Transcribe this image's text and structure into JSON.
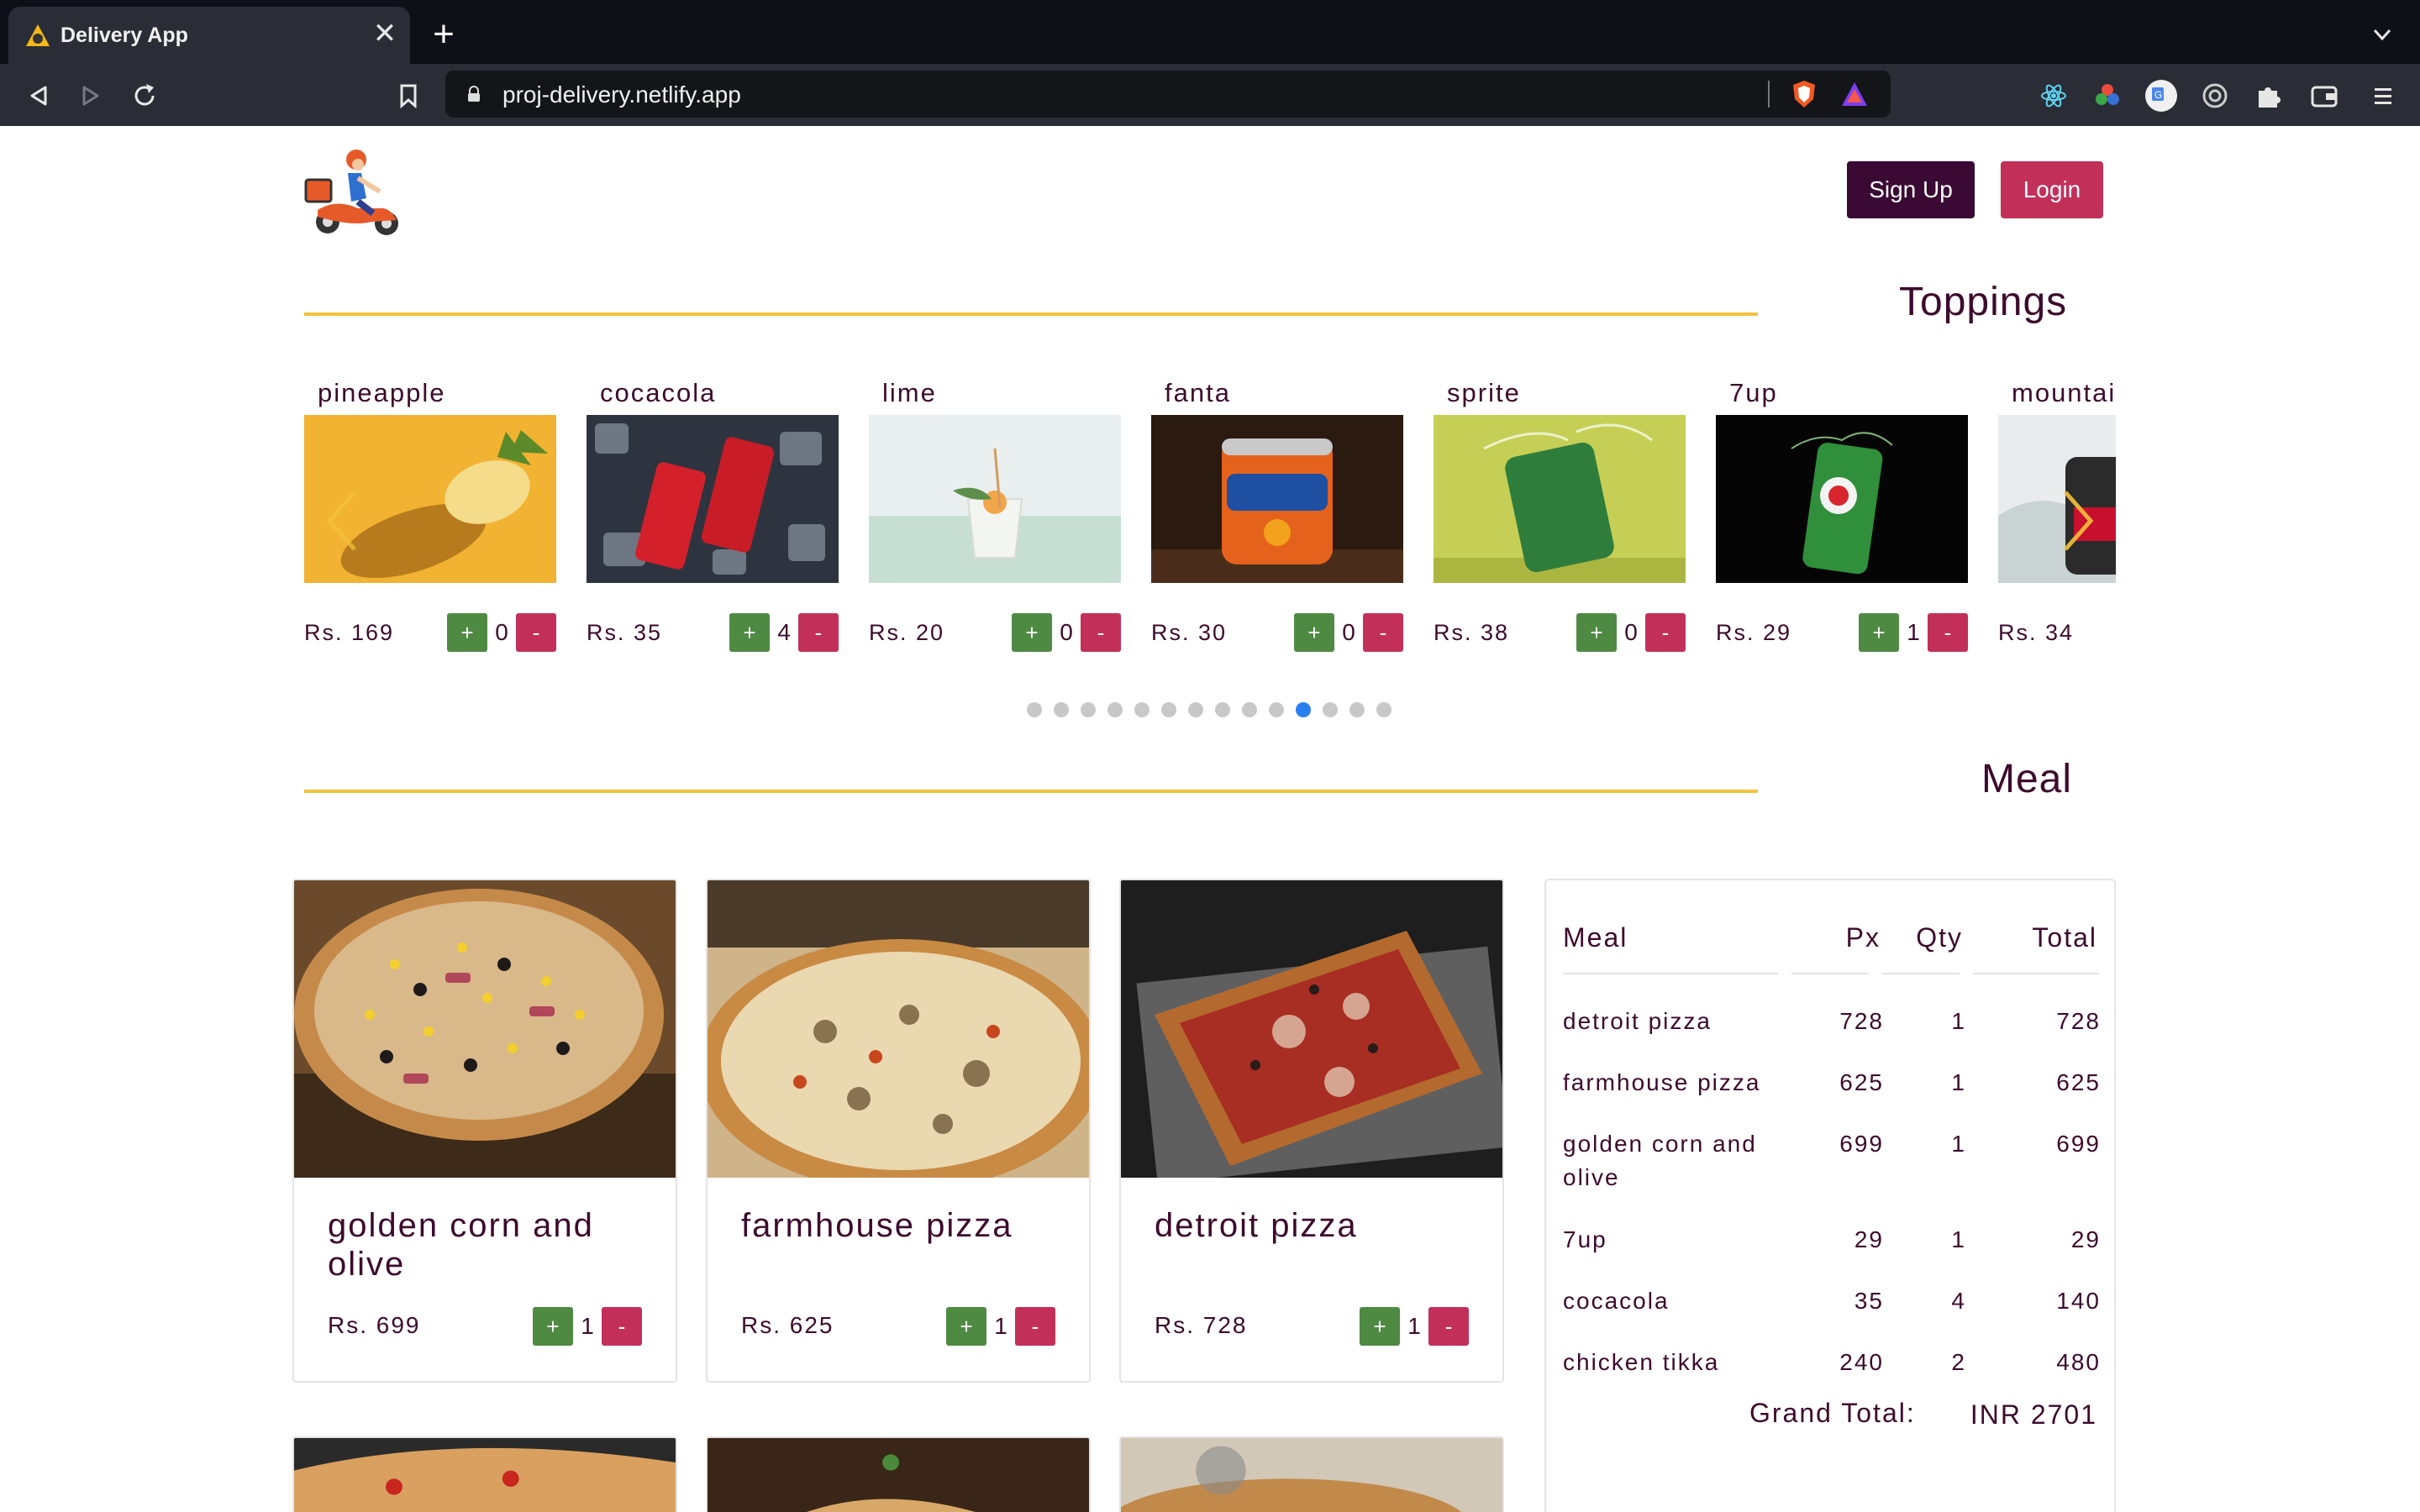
{
  "browser": {
    "tab_title": "Delivery App",
    "tab_close": "✕",
    "new_tab": "+",
    "url": "proj-delivery.netlify.app"
  },
  "header": {
    "signup_label": "Sign Up",
    "login_label": "Login"
  },
  "toppings": {
    "title": "Toppings",
    "currency": "Rs.",
    "items": [
      {
        "name": "pineapple",
        "price": "Rs. 169",
        "qty": "0"
      },
      {
        "name": "cocacola",
        "price": "Rs. 35",
        "qty": "4"
      },
      {
        "name": "lime",
        "price": "Rs. 20",
        "qty": "0"
      },
      {
        "name": "fanta",
        "price": "Rs. 30",
        "qty": "0"
      },
      {
        "name": "sprite",
        "price": "Rs. 38",
        "qty": "0"
      },
      {
        "name": "7up",
        "price": "Rs. 29",
        "qty": "1"
      },
      {
        "name": "mountai",
        "price": "Rs. 34",
        "qty": ""
      }
    ],
    "dots_count": 14,
    "active_dot": 10
  },
  "meal": {
    "title": "Meal",
    "cards": [
      {
        "name": "golden corn and olive",
        "price": "Rs. 699",
        "qty": "1"
      },
      {
        "name": "farmhouse pizza",
        "price": "Rs. 625",
        "qty": "1"
      },
      {
        "name": "detroit pizza",
        "price": "Rs. 728",
        "qty": "1"
      }
    ]
  },
  "cart": {
    "headers": {
      "meal": "Meal",
      "px": "Px",
      "qty": "Qty",
      "total": "Total"
    },
    "rows": [
      {
        "meal": "detroit pizza",
        "px": "728",
        "qty": "1",
        "total": "728"
      },
      {
        "meal": "farmhouse pizza",
        "px": "625",
        "qty": "1",
        "total": "625"
      },
      {
        "meal": "golden corn and olive",
        "px": "699",
        "qty": "1",
        "total": "699"
      },
      {
        "meal": "7up",
        "px": "29",
        "qty": "1",
        "total": "29"
      },
      {
        "meal": "cocacola",
        "px": "35",
        "qty": "4",
        "total": "140"
      },
      {
        "meal": "chicken tikka",
        "px": "240",
        "qty": "2",
        "total": "480"
      }
    ],
    "grand_total_label": "Grand Total:",
    "grand_total_value": "INR 2701"
  },
  "buttons": {
    "plus": "+",
    "minus": "-"
  },
  "colors": {
    "accent_line": "#f3c13b",
    "text": "#3d0a2d",
    "signup_bg": "#3a0a35",
    "login_bg": "#c2305a",
    "plus_bg": "#4f8a43",
    "minus_bg": "#c2305a",
    "active_dot": "#2a7ef0"
  }
}
